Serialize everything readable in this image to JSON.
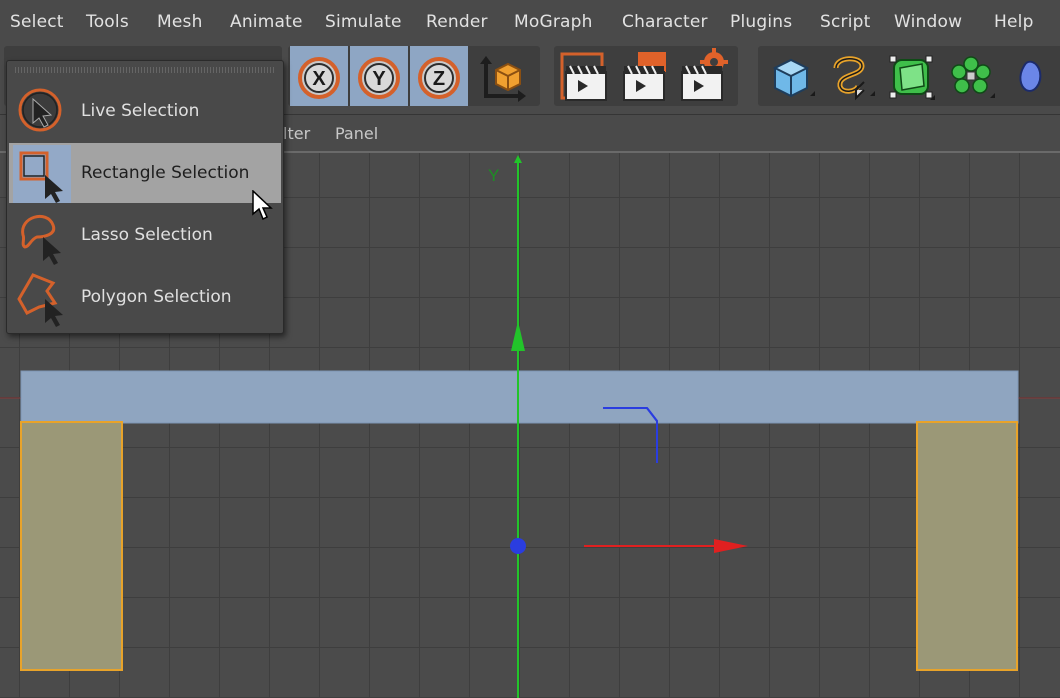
{
  "menubar": {
    "items": [
      "Select",
      "Tools",
      "Mesh",
      "Animate",
      "Simulate",
      "Render",
      "MoGraph",
      "Character",
      "Plugins",
      "Script",
      "Window",
      "Help"
    ]
  },
  "toolbar": {
    "axis_buttons": [
      "X",
      "Y",
      "Z"
    ]
  },
  "viewport_menu": {
    "items": [
      "lter",
      "Panel"
    ]
  },
  "viewport": {
    "axis_label": "Y"
  },
  "selection_menu": {
    "items": [
      {
        "label": "Live Selection",
        "icon": "live-selection-icon"
      },
      {
        "label": "Rectangle Selection",
        "icon": "rectangle-selection-icon",
        "highlighted": true
      },
      {
        "label": "Lasso Selection",
        "icon": "lasso-selection-icon"
      },
      {
        "label": "Polygon Selection",
        "icon": "polygon-selection-icon"
      }
    ]
  },
  "colors": {
    "accent_orange": "#e0622a",
    "selection_blue": "#8ea6c4",
    "axis_x": "#e02020",
    "axis_y": "#20c020",
    "axis_z": "#2a3de0",
    "object_fill": "#9b9877",
    "object_edge": "#e8a32a"
  }
}
